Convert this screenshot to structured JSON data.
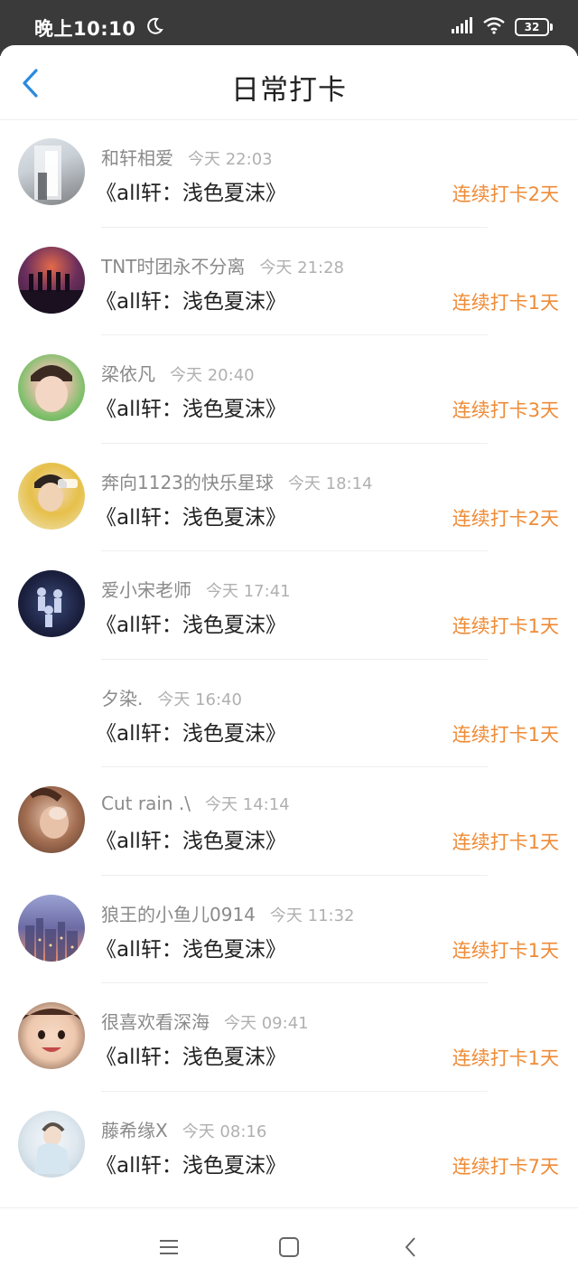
{
  "status_bar": {
    "time": "晚上10:10",
    "battery": "32"
  },
  "header": {
    "title": "日常打卡"
  },
  "checkins": [
    {
      "username": "和轩相爱",
      "time": "今天 22:03",
      "book": "《all轩：浅色夏沫》",
      "streak": "连续打卡2天"
    },
    {
      "username": "TNT时团永不分离",
      "time": "今天 21:28",
      "book": "《all轩：浅色夏沫》",
      "streak": "连续打卡1天"
    },
    {
      "username": "梁依凡",
      "time": "今天 20:40",
      "book": "《all轩：浅色夏沫》",
      "streak": "连续打卡3天"
    },
    {
      "username": "奔向1123的快乐星球",
      "time": "今天 18:14",
      "book": "《all轩：浅色夏沫》",
      "streak": "连续打卡2天"
    },
    {
      "username": "爱小宋老师",
      "time": "今天 17:41",
      "book": "《all轩：浅色夏沫》",
      "streak": "连续打卡1天"
    },
    {
      "username": "夕染.",
      "time": "今天 16:40",
      "book": "《all轩：浅色夏沫》",
      "streak": "连续打卡1天"
    },
    {
      "username": "Cut rain .\\",
      "time": "今天 14:14",
      "book": "《all轩：浅色夏沫》",
      "streak": "连续打卡1天"
    },
    {
      "username": "狼王的小鱼儿0914",
      "time": "今天 11:32",
      "book": "《all轩：浅色夏沫》",
      "streak": "连续打卡1天"
    },
    {
      "username": "很喜欢看深海",
      "time": "今天 09:41",
      "book": "《all轩：浅色夏沫》",
      "streak": "连续打卡1天"
    },
    {
      "username": "藤希缘X",
      "time": "今天 08:16",
      "book": "《all轩：浅色夏沫》",
      "streak": "连续打卡7天"
    }
  ],
  "colors": {
    "streak": "#ef8b36",
    "back_icon": "#2a8ae0",
    "status_bar_bg": "#3a3a3a"
  },
  "icons": [
    "moon-icon",
    "signal-icon",
    "wifi-icon",
    "battery-icon",
    "back-icon",
    "menu-nav-icon",
    "home-nav-icon",
    "back-nav-icon"
  ]
}
